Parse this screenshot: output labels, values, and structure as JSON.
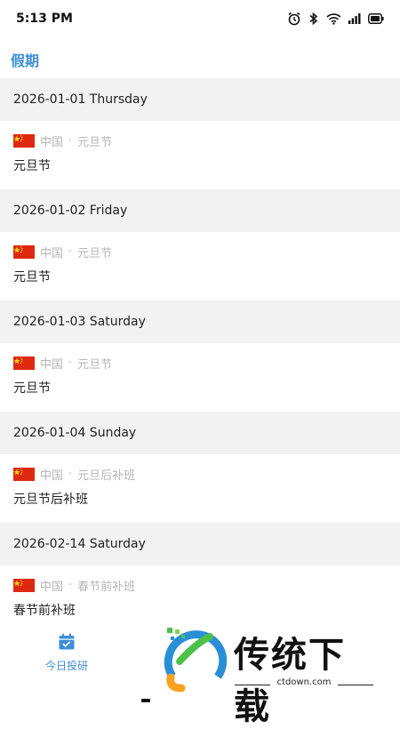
{
  "status_bar": {
    "time": "5:13 PM",
    "icons": [
      "alarm-icon",
      "bluetooth-icon",
      "wifi-icon",
      "signal-icon",
      "battery-icon"
    ]
  },
  "page": {
    "title": "假期"
  },
  "days": [
    {
      "date": "2026-01-01 Thursday",
      "country": "中国",
      "separator": "·",
      "holiday": "元旦节",
      "name": "元旦节"
    },
    {
      "date": "2026-01-02 Friday",
      "country": "中国",
      "separator": "·",
      "holiday": "元旦节",
      "name": "元旦节"
    },
    {
      "date": "2026-01-03 Saturday",
      "country": "中国",
      "separator": "·",
      "holiday": "元旦节",
      "name": "元旦节"
    },
    {
      "date": "2026-01-04 Sunday",
      "country": "中国",
      "separator": "·",
      "holiday": "元旦后补班",
      "name": "元旦节后补班"
    },
    {
      "date": "2026-02-14 Saturday",
      "country": "中国",
      "separator": "·",
      "holiday": "春节前补班",
      "name": "春节前补班"
    }
  ],
  "bottom_nav": {
    "items": [
      {
        "label": "今日投研",
        "icon": "calendar-check-icon"
      }
    ]
  },
  "watermark": {
    "text": "传统下载",
    "url": "ctdown.com",
    "icon": "ctdown-logo"
  },
  "colors": {
    "accent": "#3d8fd8",
    "header_bg": "#f2f2f2",
    "flag_red": "#de2910",
    "muted_text": "#b5b5b5"
  }
}
